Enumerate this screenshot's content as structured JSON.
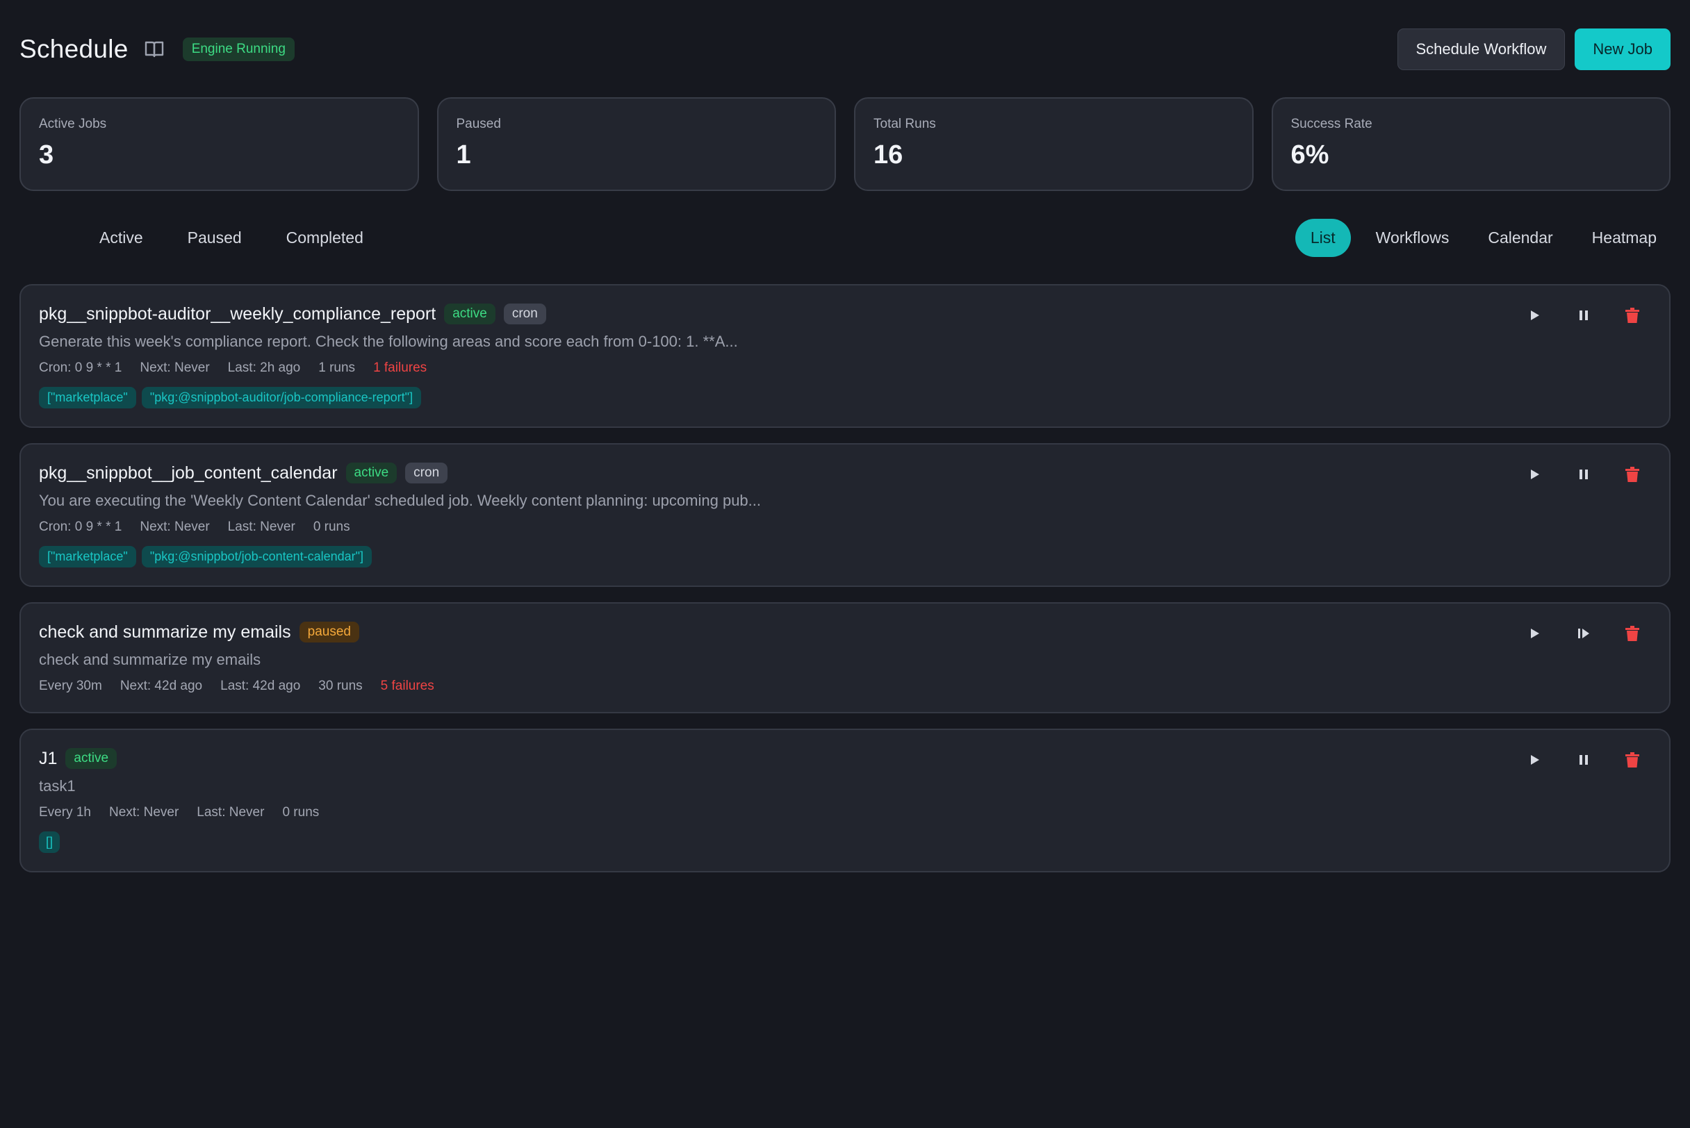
{
  "header": {
    "title": "Schedule",
    "engine_status": "Engine Running",
    "schedule_workflow_label": "Schedule Workflow",
    "new_job_label": "New Job"
  },
  "stats": [
    {
      "label": "Active Jobs",
      "value": "3"
    },
    {
      "label": "Paused",
      "value": "1"
    },
    {
      "label": "Total Runs",
      "value": "16"
    },
    {
      "label": "Success Rate",
      "value": "6%"
    }
  ],
  "filters": {
    "status_tabs": [
      "Active",
      "Paused",
      "Completed"
    ],
    "view_tabs": [
      "List",
      "Workflows",
      "Calendar",
      "Heatmap"
    ],
    "active_view": "List"
  },
  "jobs": [
    {
      "title": "pkg__snippbot-auditor__weekly_compliance_report",
      "status": "active",
      "type": "cron",
      "description": "Generate this week's compliance report. Check the following areas and score each from 0-100: 1. **A...",
      "schedule": "Cron: 0 9 * * 1",
      "next": "Next: Never",
      "last": "Last: 2h ago",
      "runs": "1 runs",
      "failures": "1 failures",
      "tags": [
        "[\"marketplace\"",
        "\"pkg:@snippbot-auditor/job-compliance-report\"]"
      ]
    },
    {
      "title": "pkg__snippbot__job_content_calendar",
      "status": "active",
      "type": "cron",
      "description": "You are executing the 'Weekly Content Calendar' scheduled job. Weekly content planning: upcoming pub...",
      "schedule": "Cron: 0 9 * * 1",
      "next": "Next: Never",
      "last": "Last: Never",
      "runs": "0 runs",
      "failures": "",
      "tags": [
        "[\"marketplace\"",
        "\"pkg:@snippbot/job-content-calendar\"]"
      ]
    },
    {
      "title": "check and summarize my emails",
      "status": "paused",
      "type": "",
      "description": "check and summarize my emails",
      "schedule": "Every 30m",
      "next": "Next: 42d ago",
      "last": "Last: 42d ago",
      "runs": "30 runs",
      "failures": "5 failures",
      "tags": []
    },
    {
      "title": "J1",
      "status": "active",
      "type": "",
      "description": "task1",
      "schedule": "Every 1h",
      "next": "Next: Never",
      "last": "Last: Never",
      "runs": "0 runs",
      "failures": "",
      "tags": [
        "[]"
      ]
    }
  ],
  "colors": {
    "accent": "#14c9c9",
    "active_green": "#3ddc84",
    "paused_orange": "#f4a83a",
    "failure_red": "#ef4444",
    "background": "#16181f"
  },
  "icons": {
    "header": "book-icon",
    "actions": [
      "play-icon",
      "pause-icon",
      "resume-icon",
      "trash-icon"
    ]
  }
}
